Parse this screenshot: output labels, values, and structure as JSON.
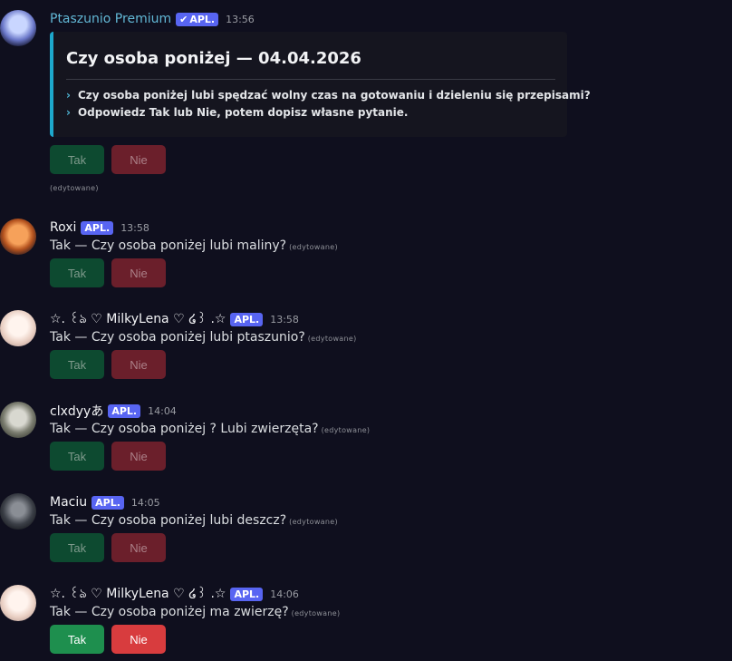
{
  "messages": [
    {
      "author": "Ptaszunio Premium",
      "badge": "APL.",
      "time": "13:56",
      "embed": {
        "title": "Czy osoba poniżej — 04.04.2026",
        "lines": [
          "Czy osoba poniżej lubi spędzać wolny czas na gotowaniu i dzieleniu się przepisami?",
          "Odpowiedz Tak lub Nie, potem dopisz własne pytanie."
        ]
      },
      "edited": "(edytowane)"
    },
    {
      "author": "Roxi",
      "badge": "APL.",
      "time": "13:58",
      "text": "Tak — Czy osoba poniżej lubi maliny?",
      "edited": "(edytowane)"
    },
    {
      "author": "☆. ꒰ঌ ♡ MilkyLena ♡ ໒꒱ .☆",
      "badge": "APL.",
      "time": "13:58",
      "text": "Tak — Czy osoba poniżej lubi ptaszunio?",
      "edited": "(edytowane)"
    },
    {
      "author": "clxdyyあ",
      "badge": "APL.",
      "time": "14:04",
      "text": "Tak — Czy osoba poniżej ? Lubi zwierzęta?",
      "edited": "(edytowane)"
    },
    {
      "author": "Maciu",
      "badge": "APL.",
      "time": "14:05",
      "text": "Tak — Czy osoba poniżej lubi deszcz?",
      "edited": "(edytowane)"
    },
    {
      "author": "☆. ꒰ঌ ♡ MilkyLena ♡ ໒꒱ .☆",
      "badge": "APL.",
      "time": "14:06",
      "text": "Tak — Czy osoba poniżej ma zwierzę?",
      "edited": "(edytowane)"
    }
  ],
  "buttons": {
    "yes": "Tak",
    "no": "Nie"
  },
  "icons": {
    "verified": "check-icon"
  },
  "colors": {
    "yes_active": "#1e8f4e",
    "no_active": "#d83c3e",
    "badge": "#5865f2",
    "embed_accent": "#1da8cc"
  }
}
